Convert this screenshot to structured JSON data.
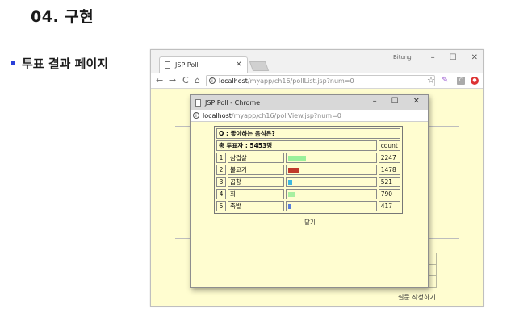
{
  "slide": {
    "title": "04. 구현",
    "bullet": "투표 결과 페이지"
  },
  "outer_browser": {
    "tab_title": "JSP Poll",
    "tab_close": "×",
    "user": "Bitong",
    "minimize": "–",
    "maximize": "☐",
    "close": "✕",
    "address_host": "localhost",
    "address_path": "/myapp/ch16/pollList.jsp?num=0",
    "back": "←",
    "forward": "→",
    "reload": "C",
    "home": "⌂",
    "star": "☆",
    "survey_link": "설문 작성하기"
  },
  "popup": {
    "title": "JSP Poll - Chrome",
    "minimize": "–",
    "maximize": "☐",
    "close": "✕",
    "address_host": "localhost",
    "address_path": "/myapp/ch16/pollView.jsp?num=0",
    "question": "Q : 좋아하는 음식은?",
    "total": "총 투표자 : 5453명",
    "count_header": "count",
    "close_link": "닫기",
    "items": [
      {
        "num": "1",
        "label": "삼겹살",
        "count": "2247",
        "color": "#9af09a"
      },
      {
        "num": "2",
        "label": "불고기",
        "count": "1478",
        "color": "#c0392b"
      },
      {
        "num": "3",
        "label": "곱창",
        "count": "521",
        "color": "#3cb8e0"
      },
      {
        "num": "4",
        "label": "회",
        "count": "790",
        "color": "#a8f0a0"
      },
      {
        "num": "5",
        "label": "족발",
        "count": "417",
        "color": "#5a7ed8"
      }
    ]
  }
}
